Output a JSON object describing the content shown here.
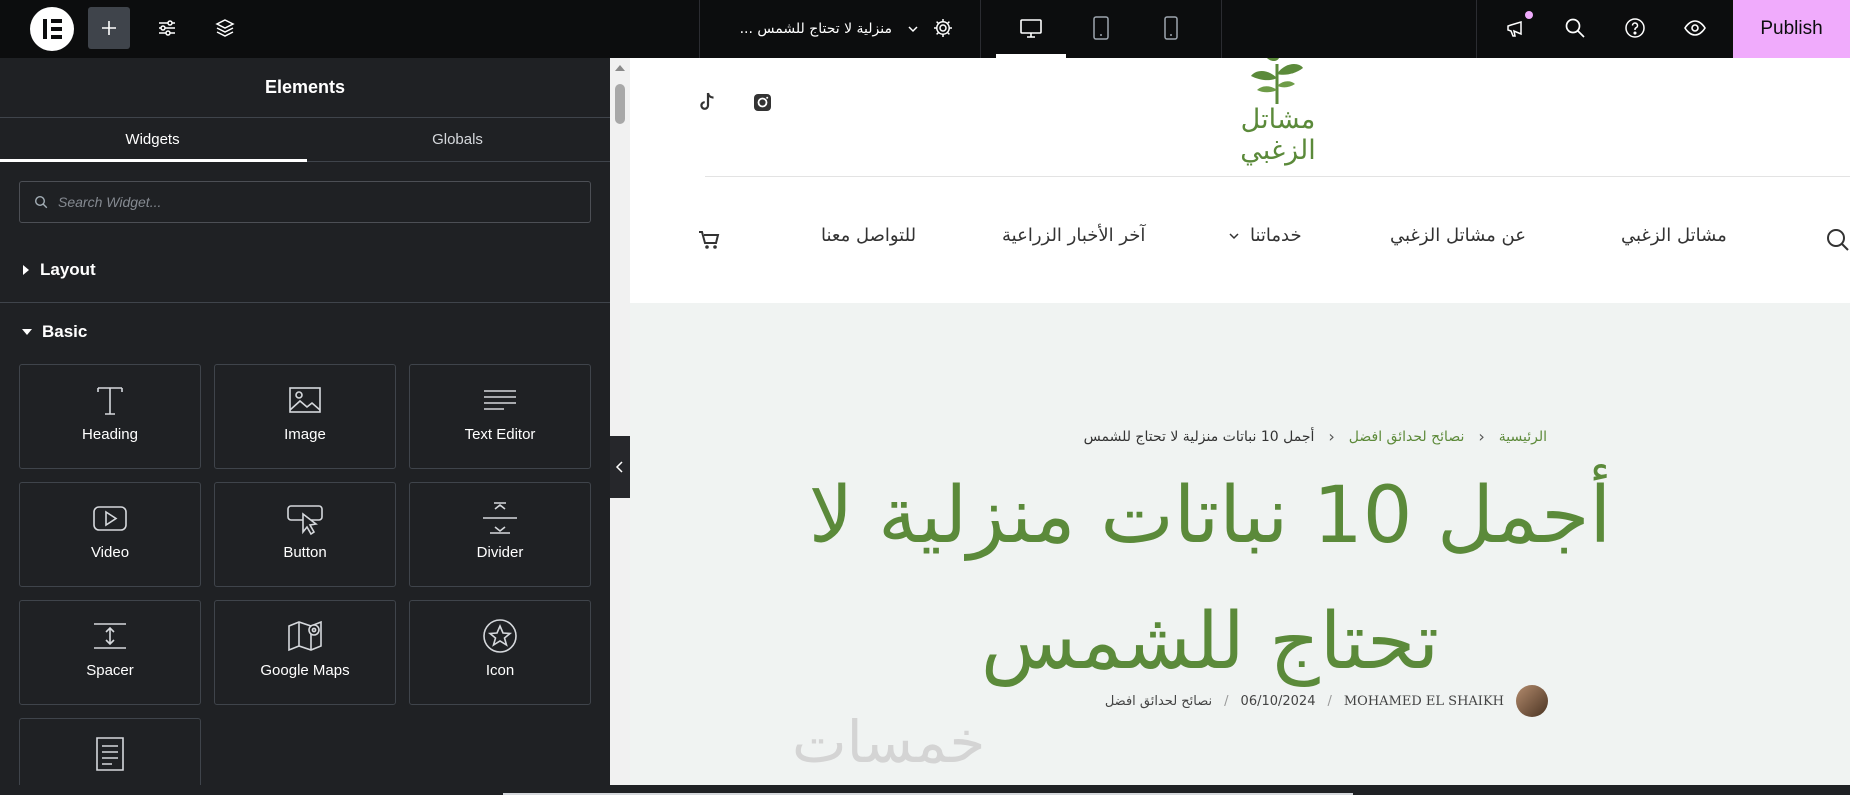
{
  "topbar": {
    "document_title": "... منزلية لا تحتاج للشمس",
    "publish_label": "Publish"
  },
  "panel": {
    "title": "Elements",
    "tabs": [
      "Widgets",
      "Globals"
    ],
    "search_placeholder": "Search Widget...",
    "categories": {
      "layout": "Layout",
      "basic": "Basic"
    },
    "widgets": {
      "heading": "Heading",
      "image": "Image",
      "text_editor": "Text Editor",
      "video": "Video",
      "button": "Button",
      "divider": "Divider",
      "spacer": "Spacer",
      "google_maps": "Google Maps",
      "icon": "Icon"
    }
  },
  "site": {
    "logo_text": "مشاتل الزغبي",
    "nav": {
      "home": "مشاتل الزغبي",
      "about": "عن مشاتل الزغبي",
      "services": "خدماتنا",
      "news": "آخر الأخبار الزراعية",
      "contact": "للتواصل معنا"
    },
    "breadcrumb": {
      "home": "الرئيسية",
      "category": "نصائح لحدائق افضل",
      "current": "أجمل 10 نباتات منزلية لا تحتاج للشمس"
    },
    "headline_line1": "أجمل 10 نباتات منزلية لا",
    "headline_line2": "تحتاج للشمس",
    "meta": {
      "author": "MOHAMED EL SHAIKH",
      "date": "06/10/2024",
      "category": "نصائح لحدائق افضل"
    },
    "watermark": "خمسات"
  },
  "colors": {
    "accent_green": "#5b8a3a",
    "publish_bg": "#f0abfc",
    "panel_bg": "#1f2124",
    "topbar_bg": "#0c0d0e"
  }
}
